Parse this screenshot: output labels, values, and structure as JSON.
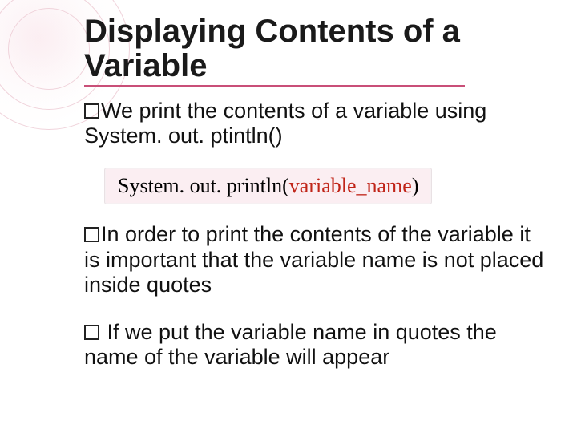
{
  "title": "Displaying Contents of a Variable",
  "bullets": {
    "b1_lead": "We",
    "b1_rest": " print the contents of a variable using System. out. ptintln()",
    "b2_lead": "In",
    "b2_rest": " order to print the contents of the variable it is important that the variable name is not placed inside quotes",
    "b3_lead": " If",
    "b3_rest": " we put the variable name in quotes the name of the  variable will appear"
  },
  "code": {
    "prefix": "System. out. println(",
    "var": "variable_name",
    "suffix": ")"
  }
}
